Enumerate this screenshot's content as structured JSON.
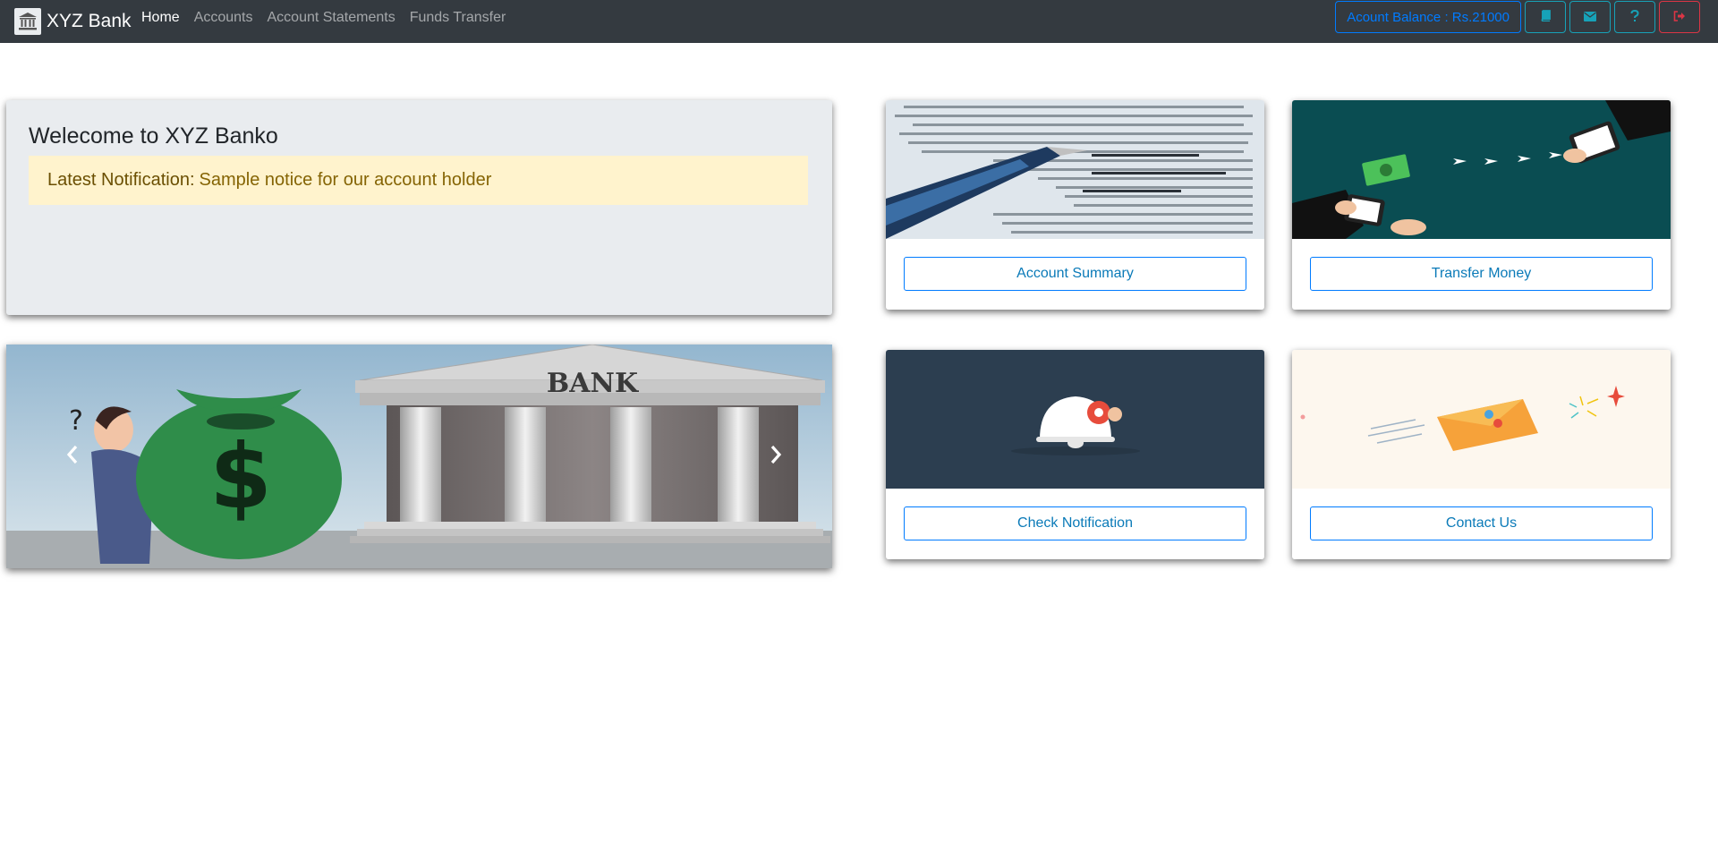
{
  "brand": {
    "name": "XYZ Bank",
    "logo_icon": "bank-icon"
  },
  "nav": {
    "links": [
      {
        "label": "Home",
        "active": true
      },
      {
        "label": "Accounts",
        "active": false
      },
      {
        "label": "Account Statements",
        "active": false
      },
      {
        "label": "Funds Transfer",
        "active": false
      }
    ],
    "balance_label": "Acount Balance : Rs.21000",
    "icon_buttons": [
      "book-icon",
      "envelope-icon",
      "question-icon",
      "sign-out-icon"
    ]
  },
  "welcome": {
    "title": "Welecome to XYZ Banko",
    "notification_label": "Latest Notification:",
    "notification_text": "Sample notice for our account holder"
  },
  "carousel": {
    "sign_text": "BANK"
  },
  "cards": [
    {
      "button_label": "Account Summary"
    },
    {
      "button_label": "Transfer Money"
    },
    {
      "button_label": "Check Notification"
    },
    {
      "button_label": "Contact Us"
    }
  ],
  "colors": {
    "navbar": "#343a40",
    "primary": "#007bff",
    "info": "#17a2b8",
    "danger": "#dc3545",
    "notice_bg": "#fff3cd"
  }
}
